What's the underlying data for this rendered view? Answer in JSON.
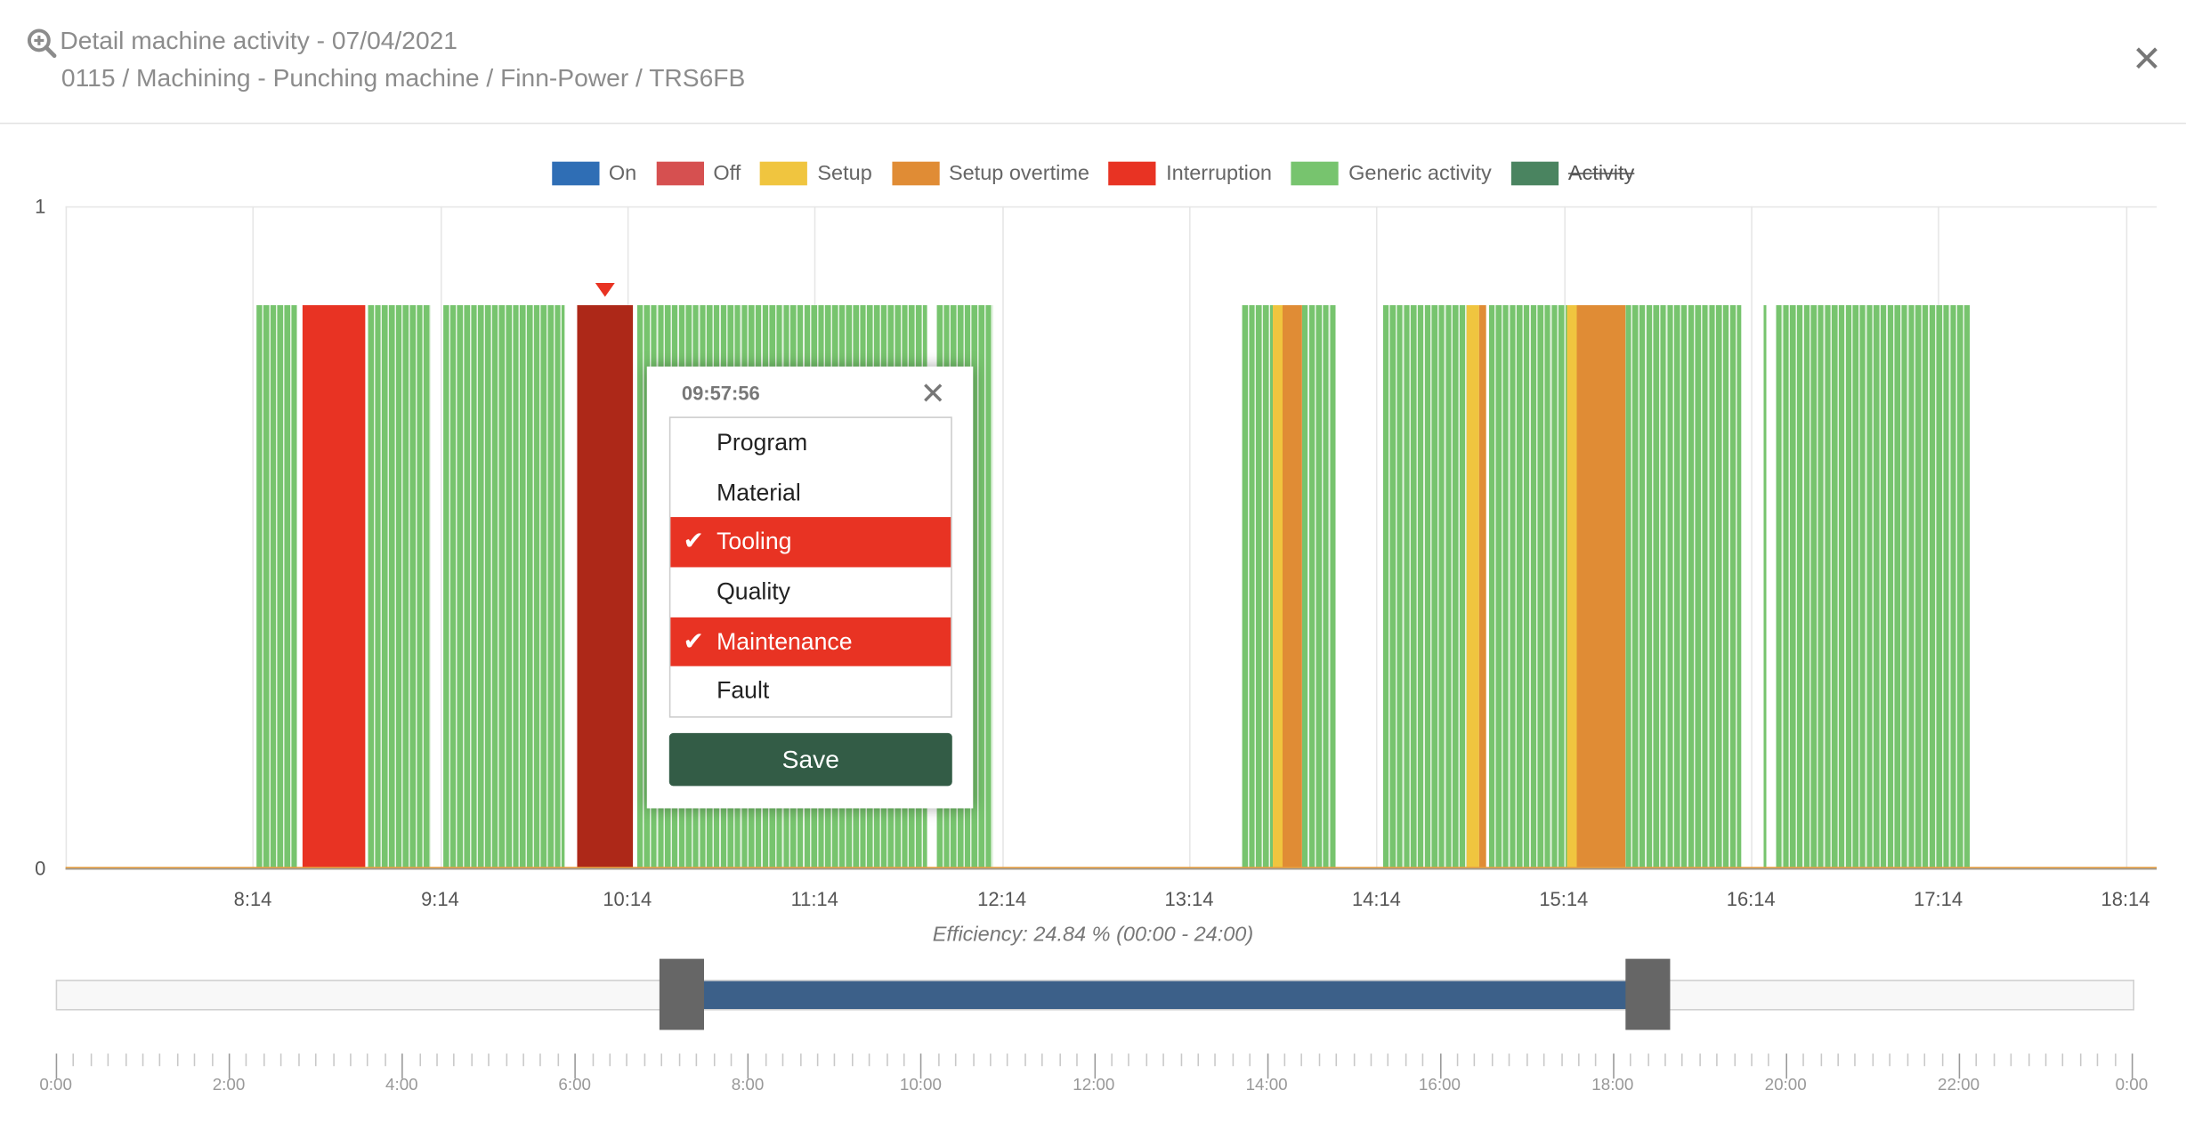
{
  "header": {
    "title": "Detail machine activity - 07/04/2021",
    "subtitle": "0115 / Machining - Punching machine / Finn-Power / TRS6FB",
    "title_icon": "zoom-in-icon",
    "close_icon": "close-icon"
  },
  "legend": [
    {
      "label": "On",
      "color": "#2f6eb5",
      "visible": true
    },
    {
      "label": "Off",
      "color": "#d65050",
      "visible": true
    },
    {
      "label": "Setup",
      "color": "#f0c53f",
      "visible": true
    },
    {
      "label": "Setup overtime",
      "color": "#e08c35",
      "visible": true
    },
    {
      "label": "Interruption",
      "color": "#e83323",
      "visible": true
    },
    {
      "label": "Generic activity",
      "color": "#77c46e",
      "visible": true
    },
    {
      "label": "Activity",
      "color": "#4a8460",
      "visible": false
    }
  ],
  "chart_data": {
    "type": "bar",
    "y_ticks": [
      "0",
      "1"
    ],
    "ylim": [
      0,
      1
    ],
    "bar_value": 0.85,
    "x_range": [
      "07:14",
      "18:24"
    ],
    "x_ticks": [
      "8:14",
      "9:14",
      "10:14",
      "11:14",
      "12:14",
      "13:14",
      "14:14",
      "15:14",
      "16:14",
      "17:14",
      "18:14"
    ],
    "grid": true,
    "selected_color": "#ad2818",
    "segments": [
      {
        "start": "08:15",
        "end": "08:28",
        "state": "Generic activity"
      },
      {
        "start": "08:30",
        "end": "08:50",
        "state": "Interruption"
      },
      {
        "start": "08:51",
        "end": "09:11",
        "state": "Generic activity"
      },
      {
        "start": "09:15",
        "end": "09:54",
        "state": "Generic activity"
      },
      {
        "start": "09:58",
        "end": "10:16",
        "state": "Interruption",
        "selected": true
      },
      {
        "start": "10:17",
        "end": "11:50",
        "state": "Generic activity"
      },
      {
        "start": "11:53",
        "end": "12:11",
        "state": "Generic activity"
      },
      {
        "start": "13:31",
        "end": "13:41",
        "state": "Generic activity"
      },
      {
        "start": "13:41",
        "end": "13:44",
        "state": "Setup"
      },
      {
        "start": "13:44",
        "end": "13:50",
        "state": "Setup overtime"
      },
      {
        "start": "13:50",
        "end": "14:01",
        "state": "Generic activity"
      },
      {
        "start": "14:16",
        "end": "14:43",
        "state": "Generic activity"
      },
      {
        "start": "14:43",
        "end": "14:47",
        "state": "Setup"
      },
      {
        "start": "14:47",
        "end": "14:49",
        "state": "Setup overtime"
      },
      {
        "start": "14:50",
        "end": "15:15",
        "state": "Generic activity"
      },
      {
        "start": "15:15",
        "end": "15:18",
        "state": "Setup"
      },
      {
        "start": "15:18",
        "end": "15:34",
        "state": "Setup overtime"
      },
      {
        "start": "15:34",
        "end": "16:11",
        "state": "Generic activity"
      },
      {
        "start": "16:18",
        "end": "16:19",
        "state": "Generic activity"
      },
      {
        "start": "16:22",
        "end": "17:24",
        "state": "Generic activity"
      }
    ]
  },
  "efficiency": "Efficiency: 24.84 % (00:00 - 24:00)",
  "range_slider": {
    "min": "0:00",
    "max": "24:00",
    "from": "07:14",
    "to": "18:24",
    "labels": [
      "0:00",
      "2:00",
      "4:00",
      "6:00",
      "8:00",
      "10:00",
      "12:00",
      "14:00",
      "16:00",
      "18:00",
      "20:00",
      "22:00",
      "0:00"
    ],
    "fill_color": "#3c6089"
  },
  "popup": {
    "time": "09:57:56",
    "close_icon": "close-icon",
    "options": [
      {
        "label": "Program",
        "selected": false
      },
      {
        "label": "Material",
        "selected": false
      },
      {
        "label": "Tooling",
        "selected": true
      },
      {
        "label": "Quality",
        "selected": false
      },
      {
        "label": "Maintenance",
        "selected": true
      },
      {
        "label": "Fault",
        "selected": false
      }
    ],
    "check_glyph": "✔",
    "save_label": "Save"
  }
}
